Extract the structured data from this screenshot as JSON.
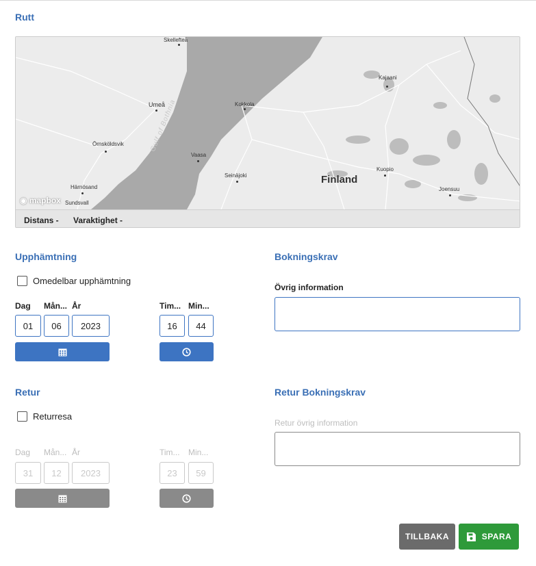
{
  "route": {
    "title": "Rutt",
    "distance_label": "Distans -",
    "duration_label": "Varaktighet -",
    "map_labels": {
      "skelleftea": "Skellefteå",
      "umea": "Umeå",
      "kokkola": "Kokkola",
      "kajaani": "Kajaani",
      "ornskoldsvik": "Örnsköldsvik",
      "vaasa": "Vaasa",
      "gulf": "Gulf of Bothnia",
      "seinajoki": "Seinäjoki",
      "finland": "Finland",
      "kuopio": "Kuopio",
      "harnosand": "Härnösand",
      "sundsvall": "Sundsvall",
      "joensuu": "Joensuu"
    },
    "logo": "mapbox"
  },
  "pickup": {
    "title": "Upphämtning",
    "immediate_label": "Omedelbar upphämtning",
    "immediate_checked": false,
    "labels": {
      "day": "Dag",
      "month": "Mån...",
      "year": "År",
      "hour": "Tim...",
      "minute": "Min..."
    },
    "day": "01",
    "month": "06",
    "year": "2023",
    "hour": "16",
    "minute": "44",
    "calendar_icon": "calendar-icon",
    "clock_icon": "clock-icon"
  },
  "return": {
    "title": "Retur",
    "return_trip_label": "Returresa",
    "return_trip_checked": false,
    "labels": {
      "day": "Dag",
      "month": "Mån...",
      "year": "År",
      "hour": "Tim...",
      "minute": "Min..."
    },
    "day": "31",
    "month": "12",
    "year": "2023",
    "hour": "23",
    "minute": "59"
  },
  "booking_requirements": {
    "title": "Bokningskrav",
    "other_info_label": "Övrig information",
    "other_info_value": ""
  },
  "return_booking_requirements": {
    "title": "Retur Bokningskrav",
    "other_info_label": "Retur övrig information",
    "other_info_value": ""
  },
  "actions": {
    "back_label": "TILLBAKA",
    "save_label": "SPARA",
    "save_icon": "floppy-disk-icon"
  },
  "colors": {
    "accent": "#3d74c2",
    "save_green": "#2e9a3a",
    "back_gray": "#6b6b6b",
    "disabled": "#8a8a8a"
  }
}
